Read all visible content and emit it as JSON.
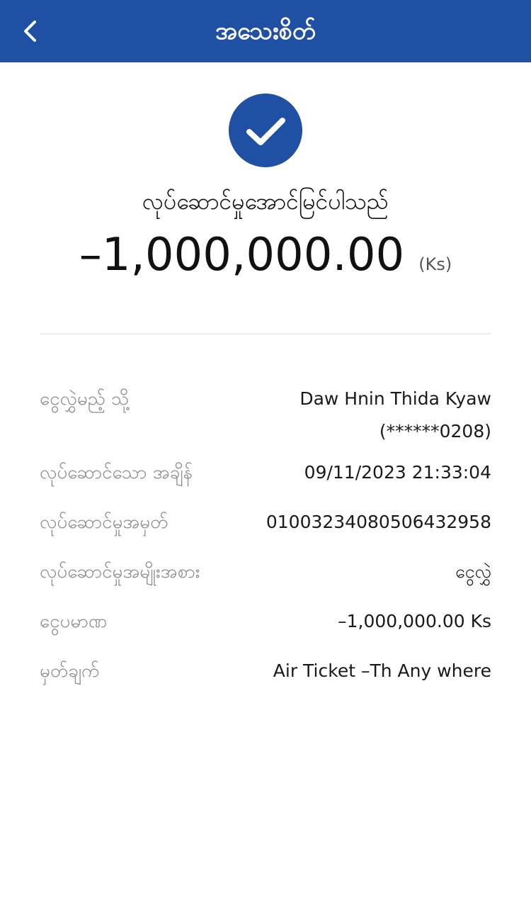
{
  "header": {
    "title": "အသေးစိတ်",
    "back_icon": "chevron-left-icon",
    "background": "#2050a4"
  },
  "status": {
    "icon": "check-circle-icon",
    "text": "လုပ်ဆောင်မှုအောင်မြင်ပါသည်"
  },
  "amount": {
    "value": "–1,000,000.00",
    "currency": "(Ks)"
  },
  "details": [
    {
      "label": "ငွေလွှဲမည့် သို့",
      "value_line1": "Daw Hnin Thida Kyaw",
      "value_line2": "(******0208)"
    },
    {
      "label": "လုပ်ဆောင်သော အချိန်",
      "value": "09/11/2023 21:33:04"
    },
    {
      "label": "လုပ်ဆောင်မှုအမှတ်",
      "value": "01003234080506432958"
    },
    {
      "label": "လုပ်ဆောင်မှုအမျိုးအစား",
      "value": "ငွေလွှဲ"
    },
    {
      "label": "ငွေပမာဏ",
      "value": "–1,000,000.00 Ks"
    },
    {
      "label": "မှတ်ချက်",
      "value": "Air Ticket –Th Any where"
    }
  ]
}
